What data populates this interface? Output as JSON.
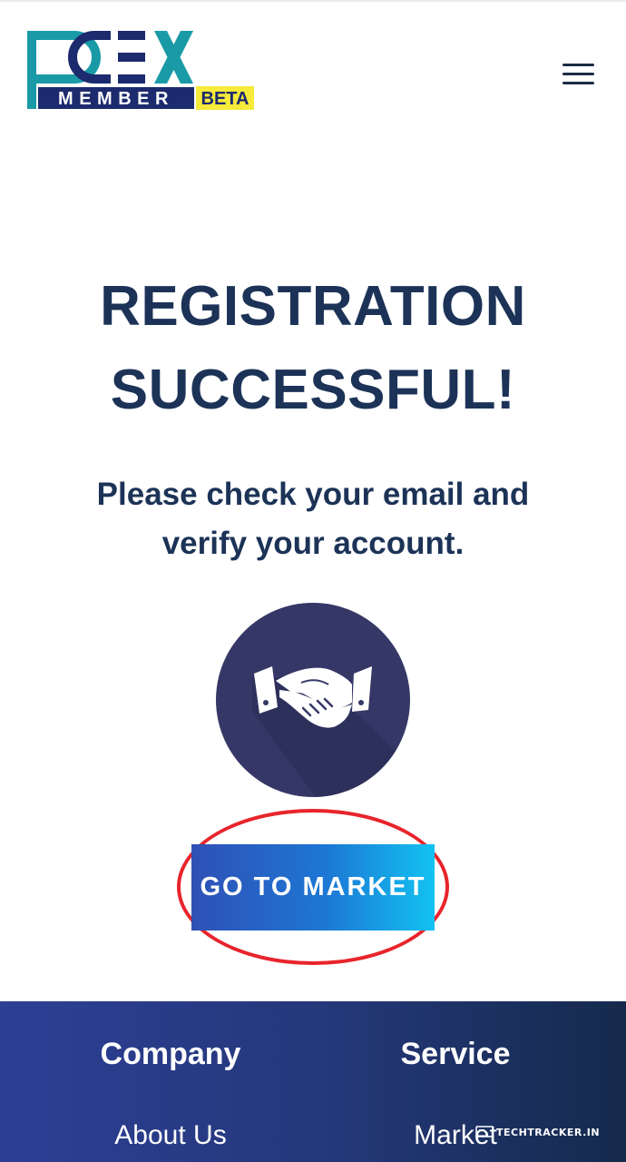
{
  "header": {
    "logo": {
      "wordmark": "PCEX",
      "member_text": "MEMBER",
      "badge": "BETA",
      "colors": {
        "teal": "#1a9aa6",
        "navy": "#1c2a6e",
        "badge_bg": "#f6ea3a"
      }
    },
    "menu_icon": "hamburger-menu-icon"
  },
  "main": {
    "title_line1": "REGISTRATION",
    "title_line2": "SUCCESSFUL!",
    "message": "Please check your email and verify your account.",
    "illustration_icon": "handshake-icon",
    "cta_label": "GO TO MARKET",
    "highlight_color": "#e8242c"
  },
  "footer": {
    "columns": [
      {
        "heading": "Company",
        "links": [
          "About Us"
        ]
      },
      {
        "heading": "Service",
        "links": [
          "Market"
        ]
      }
    ]
  },
  "watermark": {
    "text": "TECHTRACKER.IN",
    "icon": "screen-icon"
  },
  "colors": {
    "primary_text": "#1c3357",
    "circle_bg": "#353866",
    "button_gradient_start": "#2f50b5",
    "button_gradient_end": "#12c2f2",
    "footer_start": "#2d3f95",
    "footer_end": "#152a4c"
  }
}
